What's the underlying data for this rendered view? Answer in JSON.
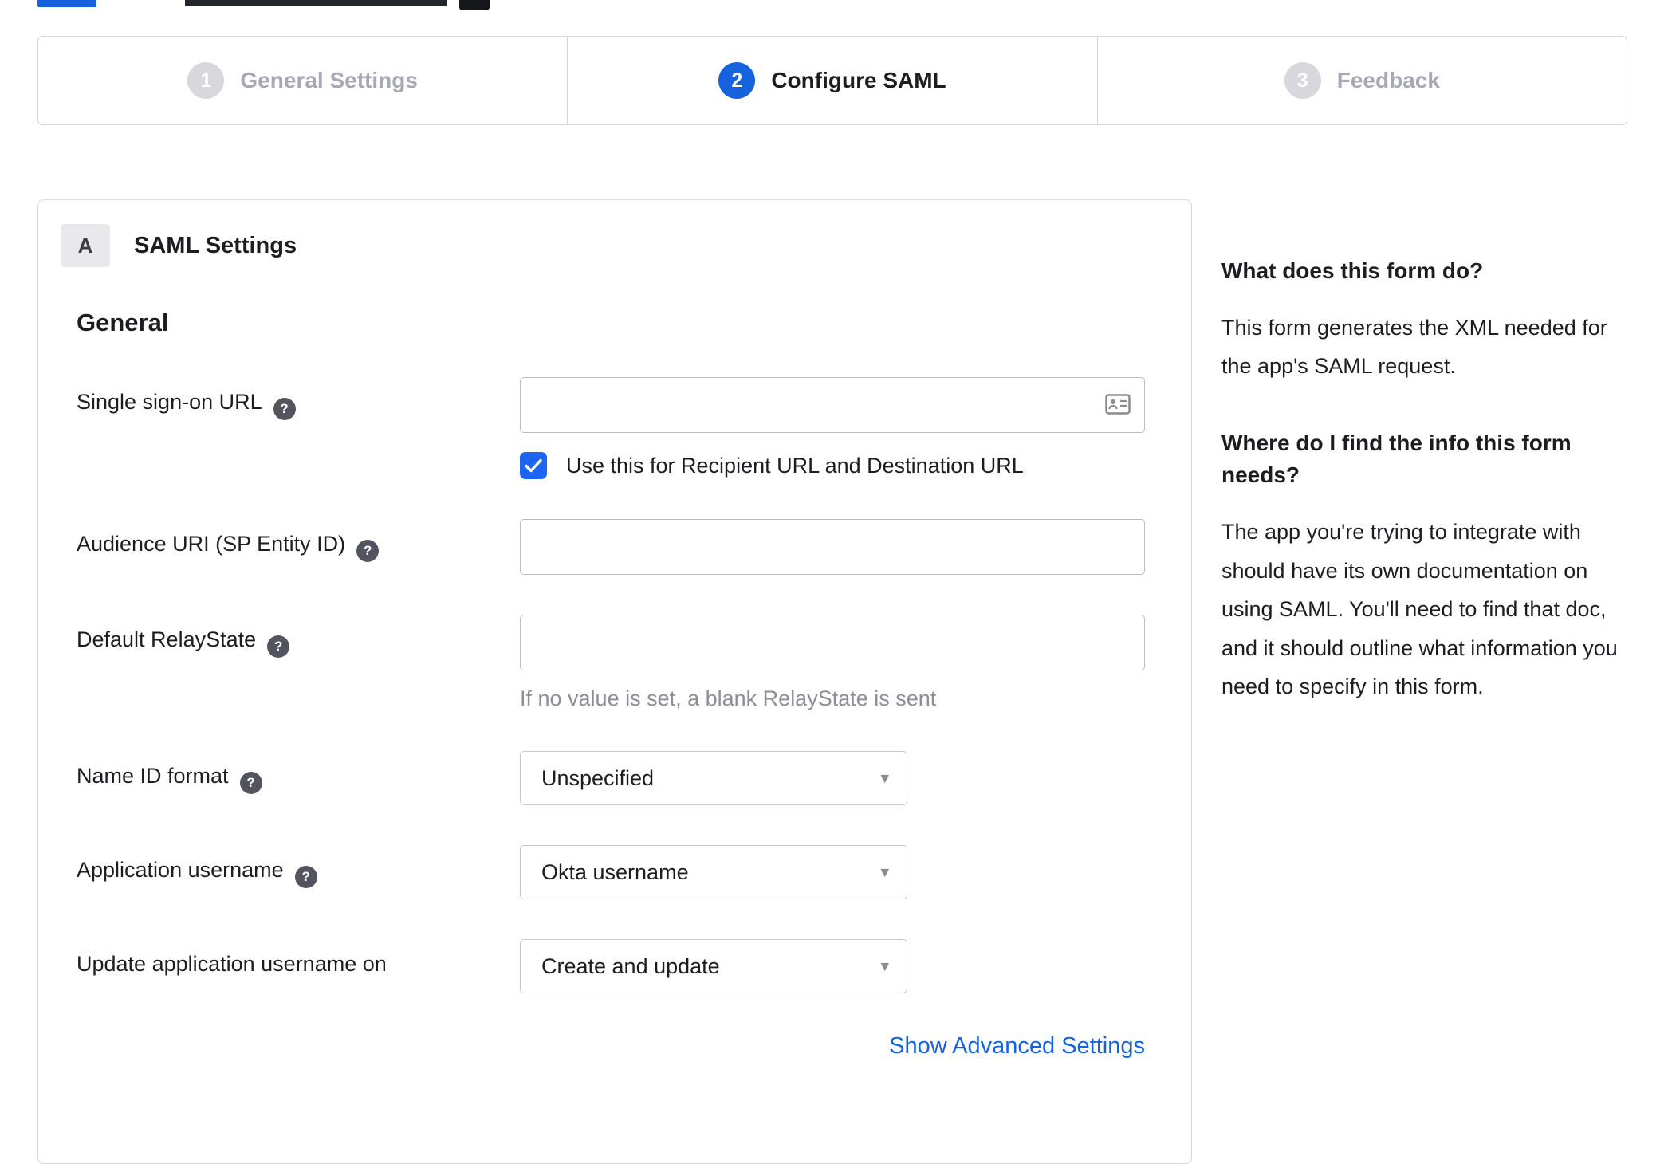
{
  "accent": "#1662dd",
  "glyphs": {
    "help": "?",
    "caret": "▾"
  },
  "stepper": {
    "steps": [
      {
        "number": "1",
        "label": "General Settings",
        "active": false
      },
      {
        "number": "2",
        "label": "Configure SAML",
        "active": true
      },
      {
        "number": "3",
        "label": "Feedback",
        "active": false
      }
    ]
  },
  "panel": {
    "badge": "A",
    "title": "SAML Settings",
    "section": "General",
    "fields": [
      {
        "label": "Single sign-on URL",
        "value": "",
        "checkbox_label": "Use this for Recipient URL and Destination URL",
        "checkbox_checked": true
      },
      {
        "label": "Audience URI (SP Entity ID)",
        "value": ""
      },
      {
        "label": "Default RelayState",
        "value": "",
        "hint": "If no value is set, a blank RelayState is sent"
      },
      {
        "label": "Name ID format",
        "value": "Unspecified"
      },
      {
        "label": "Application username",
        "value": "Okta username"
      },
      {
        "label": "Update application username on",
        "value": "Create and update"
      }
    ],
    "advanced_link": "Show Advanced Settings"
  },
  "sidebar": {
    "blocks": [
      {
        "heading": "What does this form do?",
        "body": "This form generates the XML needed for the app's SAML request."
      },
      {
        "heading": "Where do I find the info this form needs?",
        "body": "The app you're trying to integrate with should have its own documentation on using SAML. You'll need to find that doc, and it should outline what information you need to specify in this form."
      }
    ]
  }
}
